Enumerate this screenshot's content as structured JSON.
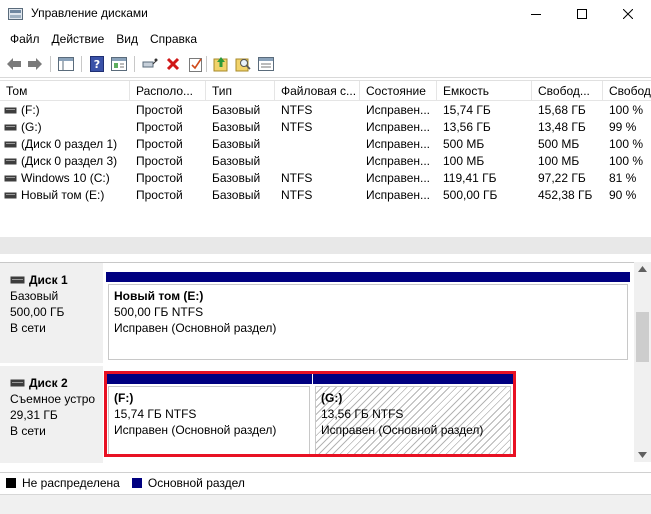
{
  "window": {
    "title": "Управление дисками"
  },
  "menu": {
    "items": [
      "Файл",
      "Действие",
      "Вид",
      "Справка"
    ]
  },
  "toolbar": {
    "icons": [
      "back-icon",
      "forward-icon",
      "console-tree-icon",
      "help-icon",
      "properties-icon",
      "connect-icon",
      "delete-icon",
      "check-icon",
      "export-icon",
      "search-icon",
      "settings-icon"
    ]
  },
  "volumes": {
    "columns": [
      "Том",
      "Располо...",
      "Тип",
      "Файловая с...",
      "Состояние",
      "Емкость",
      "Свобод...",
      "Свобод"
    ],
    "rows": [
      [
        "(F:)",
        "Простой",
        "Базовый",
        "NTFS",
        "Исправен...",
        "15,74 ГБ",
        "15,68 ГБ",
        "100 %"
      ],
      [
        "(G:)",
        "Простой",
        "Базовый",
        "NTFS",
        "Исправен...",
        "13,56 ГБ",
        "13,48 ГБ",
        "99 %"
      ],
      [
        "(Диск 0 раздел 1)",
        "Простой",
        "Базовый",
        "",
        "Исправен...",
        "500 МБ",
        "500 МБ",
        "100 %"
      ],
      [
        "(Диск 0 раздел 3)",
        "Простой",
        "Базовый",
        "",
        "Исправен...",
        "100 МБ",
        "100 МБ",
        "100 %"
      ],
      [
        "Windows 10 (C:)",
        "Простой",
        "Базовый",
        "NTFS",
        "Исправен...",
        "119,41 ГБ",
        "97,22 ГБ",
        "81 %"
      ],
      [
        "Новый том (E:)",
        "Простой",
        "Базовый",
        "NTFS",
        "Исправен...",
        "500,00 ГБ",
        "452,38 ГБ",
        "90 %"
      ]
    ]
  },
  "disks": [
    {
      "name": "Диск 1",
      "type": "Базовый",
      "size": "500,00 ГБ",
      "status": "В сети",
      "partitions": [
        {
          "name": "Новый том  (E:)",
          "info": "500,00 ГБ NTFS",
          "state": "Исправен (Основной раздел)"
        }
      ]
    },
    {
      "name": "Диск 2",
      "type": "Съемное устро",
      "size": "29,31 ГБ",
      "status": "В сети",
      "partitions": [
        {
          "name": "(F:)",
          "info": "15,74 ГБ NTFS",
          "state": "Исправен (Основной раздел)"
        },
        {
          "name": "(G:)",
          "info": "13,56 ГБ NTFS",
          "state": "Исправен (Основной раздел)"
        }
      ]
    }
  ],
  "legend": {
    "unallocated": "Не распределена",
    "primary": "Основной раздел"
  },
  "colors": {
    "primary_partition": "#000080",
    "unallocated": "#000000",
    "highlight": "#e81123"
  }
}
